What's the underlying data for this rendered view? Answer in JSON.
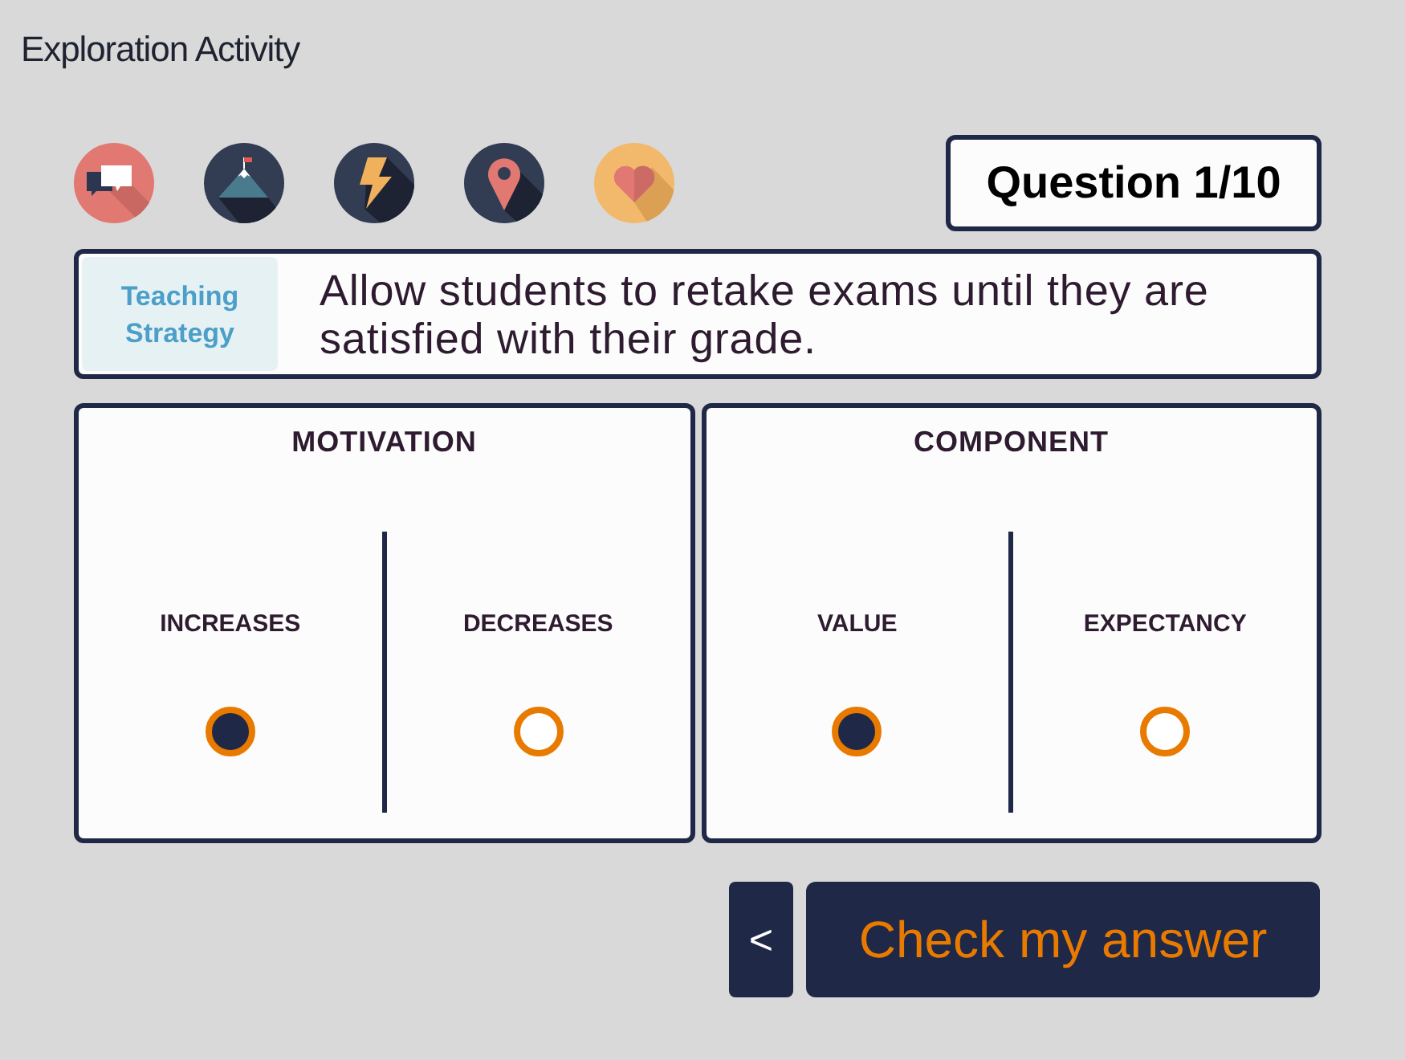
{
  "header": {
    "title": "Exploration Activity"
  },
  "question_counter": "Question 1/10",
  "strategy": {
    "label": "Teaching Strategy",
    "text": "Allow students to retake exams until they are satisfied with their grade."
  },
  "panels": [
    {
      "title": "MOTIVATION",
      "options": [
        {
          "label": "INCREASES",
          "selected": true
        },
        {
          "label": "DECREASES",
          "selected": false
        }
      ]
    },
    {
      "title": "COMPONENT",
      "options": [
        {
          "label": "VALUE",
          "selected": true
        },
        {
          "label": "EXPECTANCY",
          "selected": false
        }
      ]
    }
  ],
  "buttons": {
    "back": "<",
    "check": "Check my answer"
  }
}
